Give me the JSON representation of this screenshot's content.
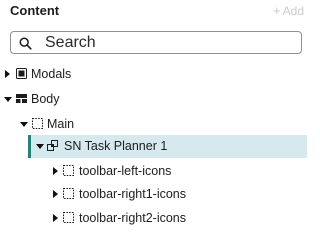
{
  "header": {
    "title": "Content",
    "add_label": "Add",
    "add_icon": "+"
  },
  "search": {
    "placeholder": "Search",
    "value": ""
  },
  "tree": {
    "items": [
      {
        "label": "Modals",
        "expanded": false,
        "icon": "modal-icon"
      },
      {
        "label": "Body",
        "expanded": true,
        "icon": "layout-icon"
      },
      {
        "label": "Main",
        "expanded": true,
        "icon": "container-icon"
      },
      {
        "label": "SN Task Planner 1",
        "expanded": true,
        "selected": true,
        "icon": "component-icon"
      },
      {
        "label": "toolbar-left-icons",
        "expanded": false,
        "icon": "container-icon"
      },
      {
        "label": "toolbar-right1-icons",
        "expanded": false,
        "icon": "container-icon"
      },
      {
        "label": "toolbar-right2-icons",
        "expanded": false,
        "icon": "container-icon"
      }
    ]
  },
  "colors": {
    "selected_bg": "#d5e9ee",
    "selected_border": "#1f8476",
    "muted": "#c9cbcd"
  }
}
